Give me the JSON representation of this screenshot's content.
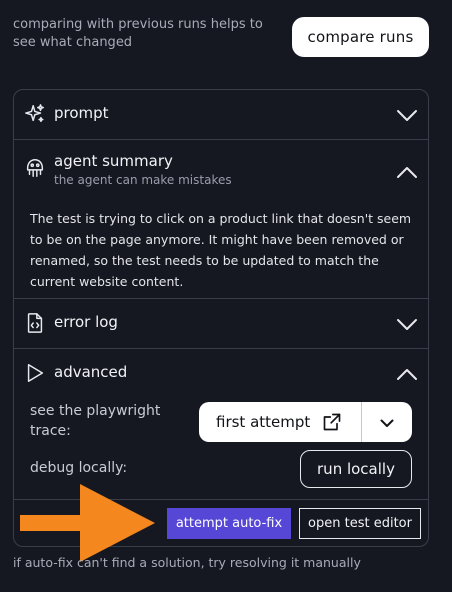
{
  "header": {
    "compare_text": "comparing with previous runs helps to see what changed",
    "compare_button": "compare runs"
  },
  "sections": {
    "prompt": {
      "title": "prompt",
      "icon": "sparkles-icon",
      "expanded": false
    },
    "summary": {
      "title": "agent summary",
      "subtitle": "the agent can make mistakes",
      "icon": "robot-icon",
      "expanded": true,
      "body": "The test is trying to click on a product link that doesn't seem to be on the page anymore. It might have been removed or renamed, so the test needs to be updated to match the current website content."
    },
    "error_log": {
      "title": "error log",
      "icon": "code-file-icon",
      "expanded": false
    },
    "advanced": {
      "title": "advanced",
      "icon": "play-icon",
      "expanded": true,
      "trace_label": "see the playwright trace:",
      "attempt_button": "first attempt",
      "debug_label": "debug locally:",
      "run_button": "run locally"
    }
  },
  "actions": {
    "autofix_button": "attempt auto-fix",
    "editor_button": "open test editor",
    "arrow_color": "#f5871f",
    "accent_color": "#5747d6"
  },
  "footer": {
    "note": "if auto-fix can't find a solution, try resolving it manually"
  }
}
